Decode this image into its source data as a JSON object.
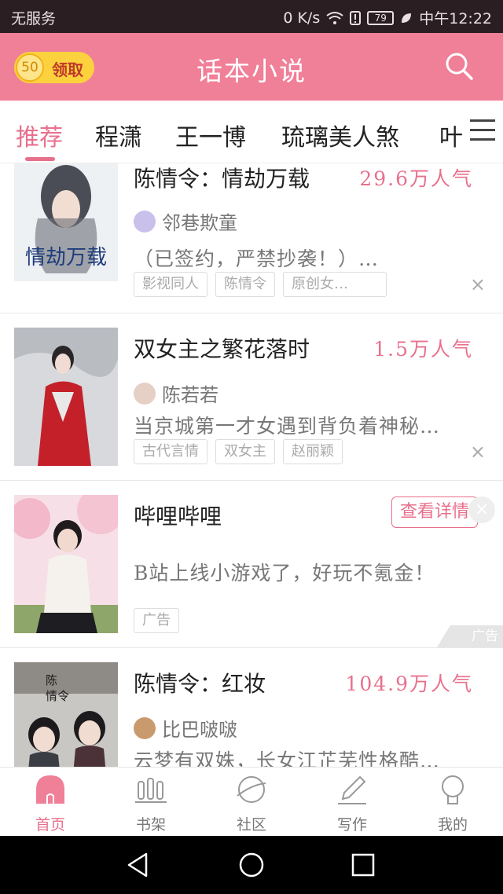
{
  "status_bar": {
    "carrier": "无服务",
    "speed": "0 K/s",
    "battery": "79",
    "time": "中午12:22"
  },
  "header": {
    "coin_amount": "50",
    "coin_label": "领取",
    "title": "话本小说",
    "search_icon": "search-icon"
  },
  "tabs": [
    {
      "label": "推荐",
      "active": true
    },
    {
      "label": "程潇"
    },
    {
      "label": "王一博"
    },
    {
      "label": "琉璃美人煞"
    },
    {
      "label": "叶"
    }
  ],
  "feed": {
    "cards": [
      {
        "title": "陈情令：情劫万载",
        "popularity": "29.6万人气",
        "author": "邻巷欺童",
        "description": "（已签约，严禁抄袭！）…",
        "tags": [
          "影视同人",
          "陈情令",
          "原创女…"
        ],
        "close": "×"
      },
      {
        "title": "双女主之繁花落时",
        "popularity": "1.5万人气",
        "author": "陈若若",
        "description": "当京城第一才女遇到背负着神秘…",
        "tags": [
          "古代言情",
          "双女主",
          "赵丽颖"
        ],
        "close": "×"
      },
      {
        "title": "哔哩哔哩",
        "button": "查看详情",
        "description": "B站上线小游戏了，好玩不氪金！",
        "tag": "广告",
        "ad_mark": "广告",
        "close": "×"
      },
      {
        "title": "陈情令：红妆",
        "popularity": "104.9万人气",
        "author": "比巴啵啵",
        "description": "云梦有双姝，长女江芷芜性格酷…"
      }
    ]
  },
  "bottom_nav": [
    {
      "label": "首页",
      "icon": "home-icon",
      "active": true
    },
    {
      "label": "书架",
      "icon": "bookshelf-icon"
    },
    {
      "label": "社区",
      "icon": "planet-icon"
    },
    {
      "label": "写作",
      "icon": "pencil-icon"
    },
    {
      "label": "我的",
      "icon": "profile-icon"
    }
  ],
  "colors": {
    "accent": "#e8708d",
    "header_bg": "#f07f98",
    "coin": "#fbd23d"
  }
}
